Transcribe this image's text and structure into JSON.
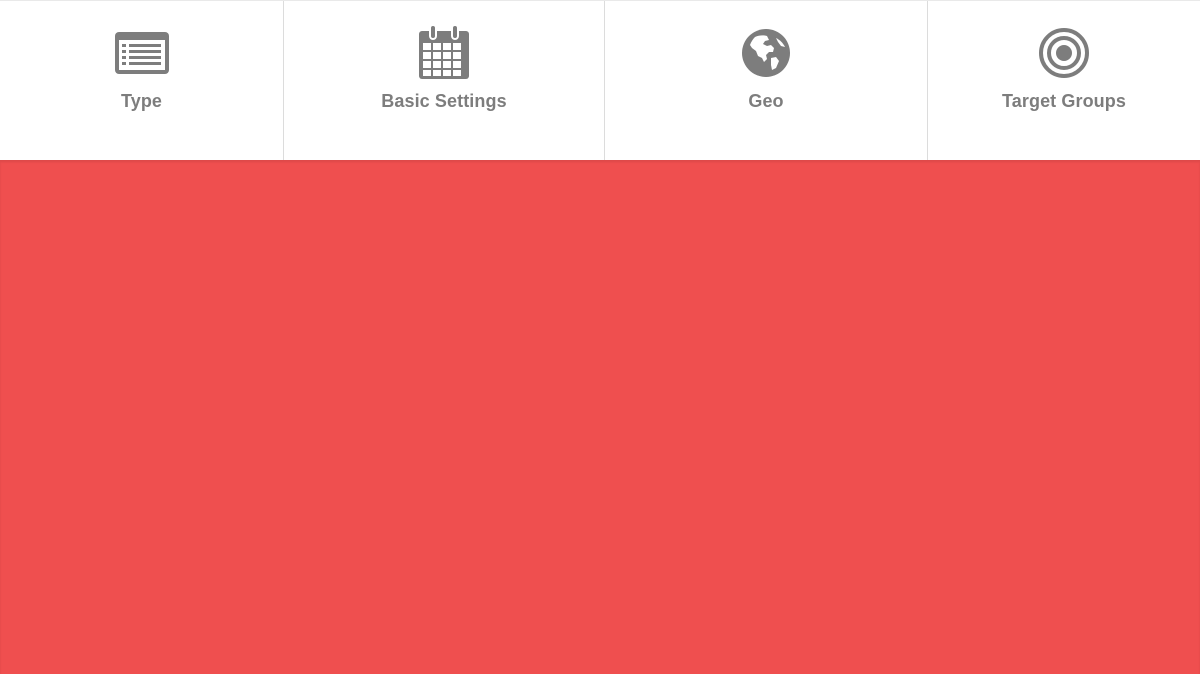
{
  "wizard": {
    "steps": [
      {
        "label": "Type",
        "icon": "list-icon"
      },
      {
        "label": "Basic Settings",
        "icon": "calendar-icon"
      },
      {
        "label": "Geo",
        "icon": "globe-icon"
      },
      {
        "label": "Target Groups",
        "icon": "target-icon"
      }
    ]
  },
  "colors": {
    "icon": "#7d7d7d",
    "label": "#7d7d7d",
    "panel_background": "#ef4f4f",
    "nav_background": "#ffffff",
    "divider": "#dcdcdc"
  }
}
